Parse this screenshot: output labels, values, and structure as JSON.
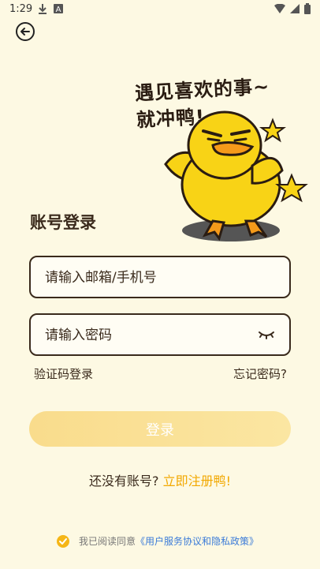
{
  "status_bar": {
    "time": "1:29"
  },
  "slogan": {
    "line1": "遇见喜欢的事~",
    "line2": "就冲鸭!"
  },
  "login": {
    "title": "账号登录",
    "account_placeholder": "请输入邮箱/手机号",
    "password_placeholder": "请输入密码",
    "code_login_label": "验证码登录",
    "forgot_password_label": "忘记密码?",
    "login_button_label": "登录"
  },
  "register": {
    "prompt": "还没有账号?",
    "link": "立即注册鸭!"
  },
  "agreement": {
    "prefix": "我已阅读同意",
    "link": "《用户服务协议和隐私政策》"
  },
  "colors": {
    "background": "#fdf9e3",
    "accent": "#f2a800",
    "button_gradient_start": "#f9dc8c",
    "link_blue": "#3b7bd8"
  },
  "icons": [
    "download-icon",
    "a-icon",
    "wifi-icon",
    "signal-icon",
    "battery-icon",
    "back-arrow-icon",
    "eye-closed-icon",
    "check-icon"
  ]
}
